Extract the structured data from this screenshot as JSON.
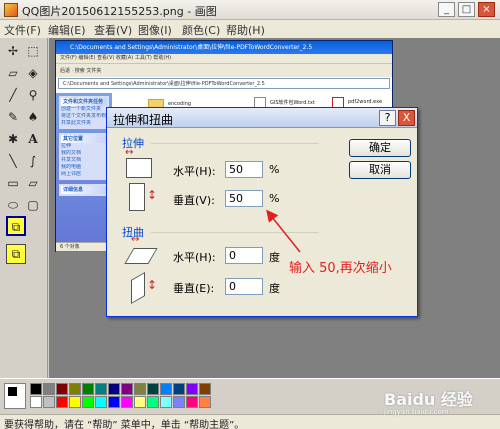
{
  "window": {
    "title": "QQ图片20150612155253.png - 画图"
  },
  "menubar": [
    "文件(F)",
    "编辑(E)",
    "查看(V)",
    "图像(I)",
    "颜色(C)",
    "帮助(H)"
  ],
  "explorer": {
    "title": "C:\\Documents and Settings\\Administrator\\桌面\\拉伸\\file-PDFToWordConverter_2.5",
    "menu": "文件(F)  编辑(E)  查看(V)  收藏(A)  工具(T)  帮助(H)",
    "toolbar": "后退  ·  搜索  文件夹",
    "address": "C:\\Documents and Settings\\Administrator\\桌面\\拉伸\\file-PDFToWordConverter_2.5",
    "task_panel_title": "文件和文件夹任务",
    "task_links": [
      "创建一个新文件夹",
      "将这个文件夹发布到 Web",
      "共享此文件夹"
    ],
    "other_title": "其它位置",
    "other_links": [
      "拉伸",
      "我的文档",
      "共享文档",
      "我的电脑",
      "网上邻居"
    ],
    "detail_title": "详细信息",
    "files": [
      "encoding",
      "GIS软件包Word.txt",
      "pdf2word.exe"
    ],
    "status": "6 个对象"
  },
  "dialog": {
    "title": "拉伸和扭曲",
    "stretch_label": "拉伸",
    "skew_label": "扭曲",
    "horizontal_label": "水平(H):",
    "vertical_label": "垂直(V):",
    "skew_horizontal_label": "水平(H):",
    "skew_vertical_label": "垂直(E):",
    "stretch_horizontal_value": "50",
    "stretch_vertical_value": "50",
    "skew_horizontal_value": "0",
    "skew_vertical_value": "0",
    "percent_unit": "%",
    "degree_unit": "度",
    "ok_label": "确定",
    "cancel_label": "取消",
    "help_button": "?",
    "close_button": "X"
  },
  "annotation": "输入 50,再次缩小",
  "palette_colors": [
    "#000000",
    "#808080",
    "#800000",
    "#808000",
    "#008000",
    "#008080",
    "#000080",
    "#800080",
    "#808040",
    "#004040",
    "#0080ff",
    "#004080",
    "#8000ff",
    "#804000",
    "#ffffff",
    "#c0c0c0",
    "#ff0000",
    "#ffff00",
    "#00ff00",
    "#00ffff",
    "#0000ff",
    "#ff00ff",
    "#ffff80",
    "#00ff80",
    "#80ffff",
    "#8080ff",
    "#ff0080",
    "#ff8040"
  ],
  "statusbar": "要获得帮助，请在 “帮助” 菜单中，单击 “帮助主题”。",
  "watermark": {
    "brand": "Baidu 经验",
    "url": "jingyan.baidu.com"
  }
}
